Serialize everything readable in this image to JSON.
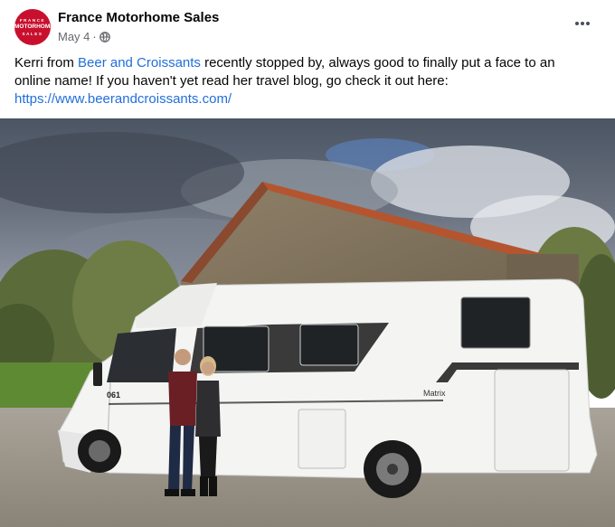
{
  "post": {
    "page_name": "France Motorhome Sales",
    "date": "May 4",
    "audience_icon": "globe-icon",
    "more_icon": "more-options-icon",
    "avatar_text": {
      "top": "FRANCE",
      "middle": "MOTORHOME",
      "bottom": "SALES"
    },
    "caption": {
      "part1": "Kerri from ",
      "link1": "Beer and Croissants",
      "part2": " recently stopped by, always good to finally put a face to an online name! If you haven't yet read her travel blog, go check it out here: ",
      "link2": "https://www.beerandcroissants.com/"
    },
    "photo": {
      "vehicle_badge": "Matrix",
      "plate_number": "061"
    }
  },
  "colors": {
    "brand_red": "#c8102e",
    "link_blue": "#216fdb",
    "meta_gray": "#65676b"
  }
}
